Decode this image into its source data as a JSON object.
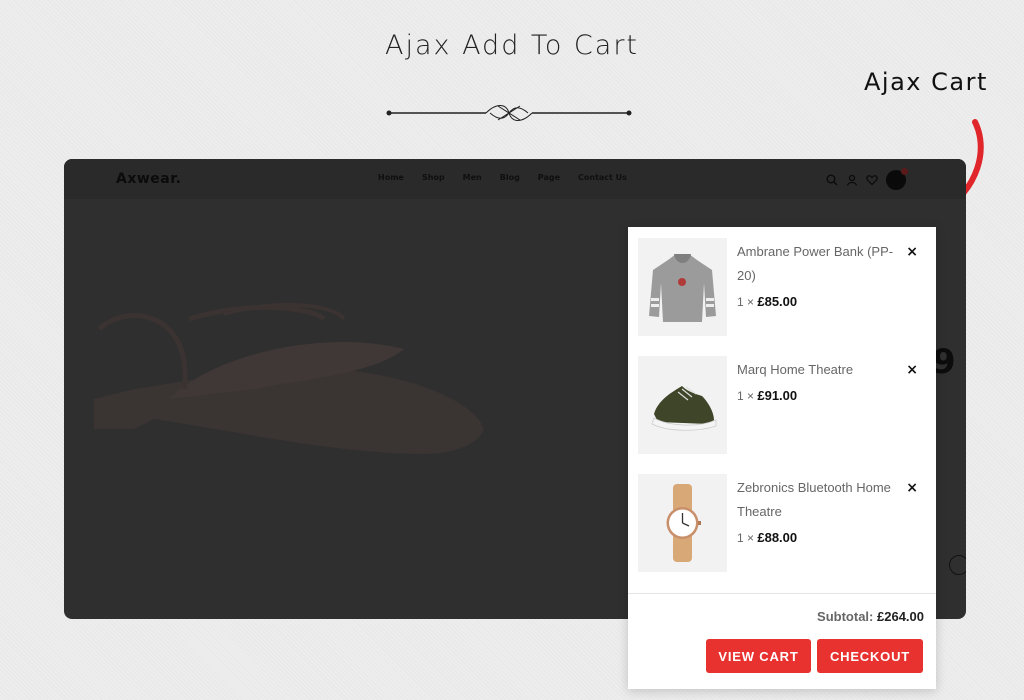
{
  "headline": "Ajax Add To Cart",
  "callout": "Ajax Cart",
  "store": {
    "logo": "Axwear.",
    "menu": [
      "Home",
      "Shop",
      "Men",
      "Blog",
      "Page",
      "Contact Us"
    ],
    "hero_text": "9"
  },
  "cart": {
    "items": [
      {
        "name": "Ambrane Power Bank (PP-20)",
        "qty": "1 ×",
        "price": "£85.00",
        "icon": "sweatshirt-icon",
        "remove": "×"
      },
      {
        "name": "Marq Home Theatre",
        "qty": "1 ×",
        "price": "£91.00",
        "icon": "sneaker-icon",
        "remove": "×"
      },
      {
        "name": "Zebronics Bluetooth Home Theatre",
        "qty": "1 ×",
        "price": "£88.00",
        "icon": "watch-icon",
        "remove": "×"
      }
    ],
    "subtotal_label": "Subtotal:",
    "subtotal_value": "£264.00",
    "view_cart": "View Cart",
    "checkout": "Checkout"
  },
  "colors": {
    "accent": "#e8322f",
    "overlay": "#2f2f2f"
  }
}
